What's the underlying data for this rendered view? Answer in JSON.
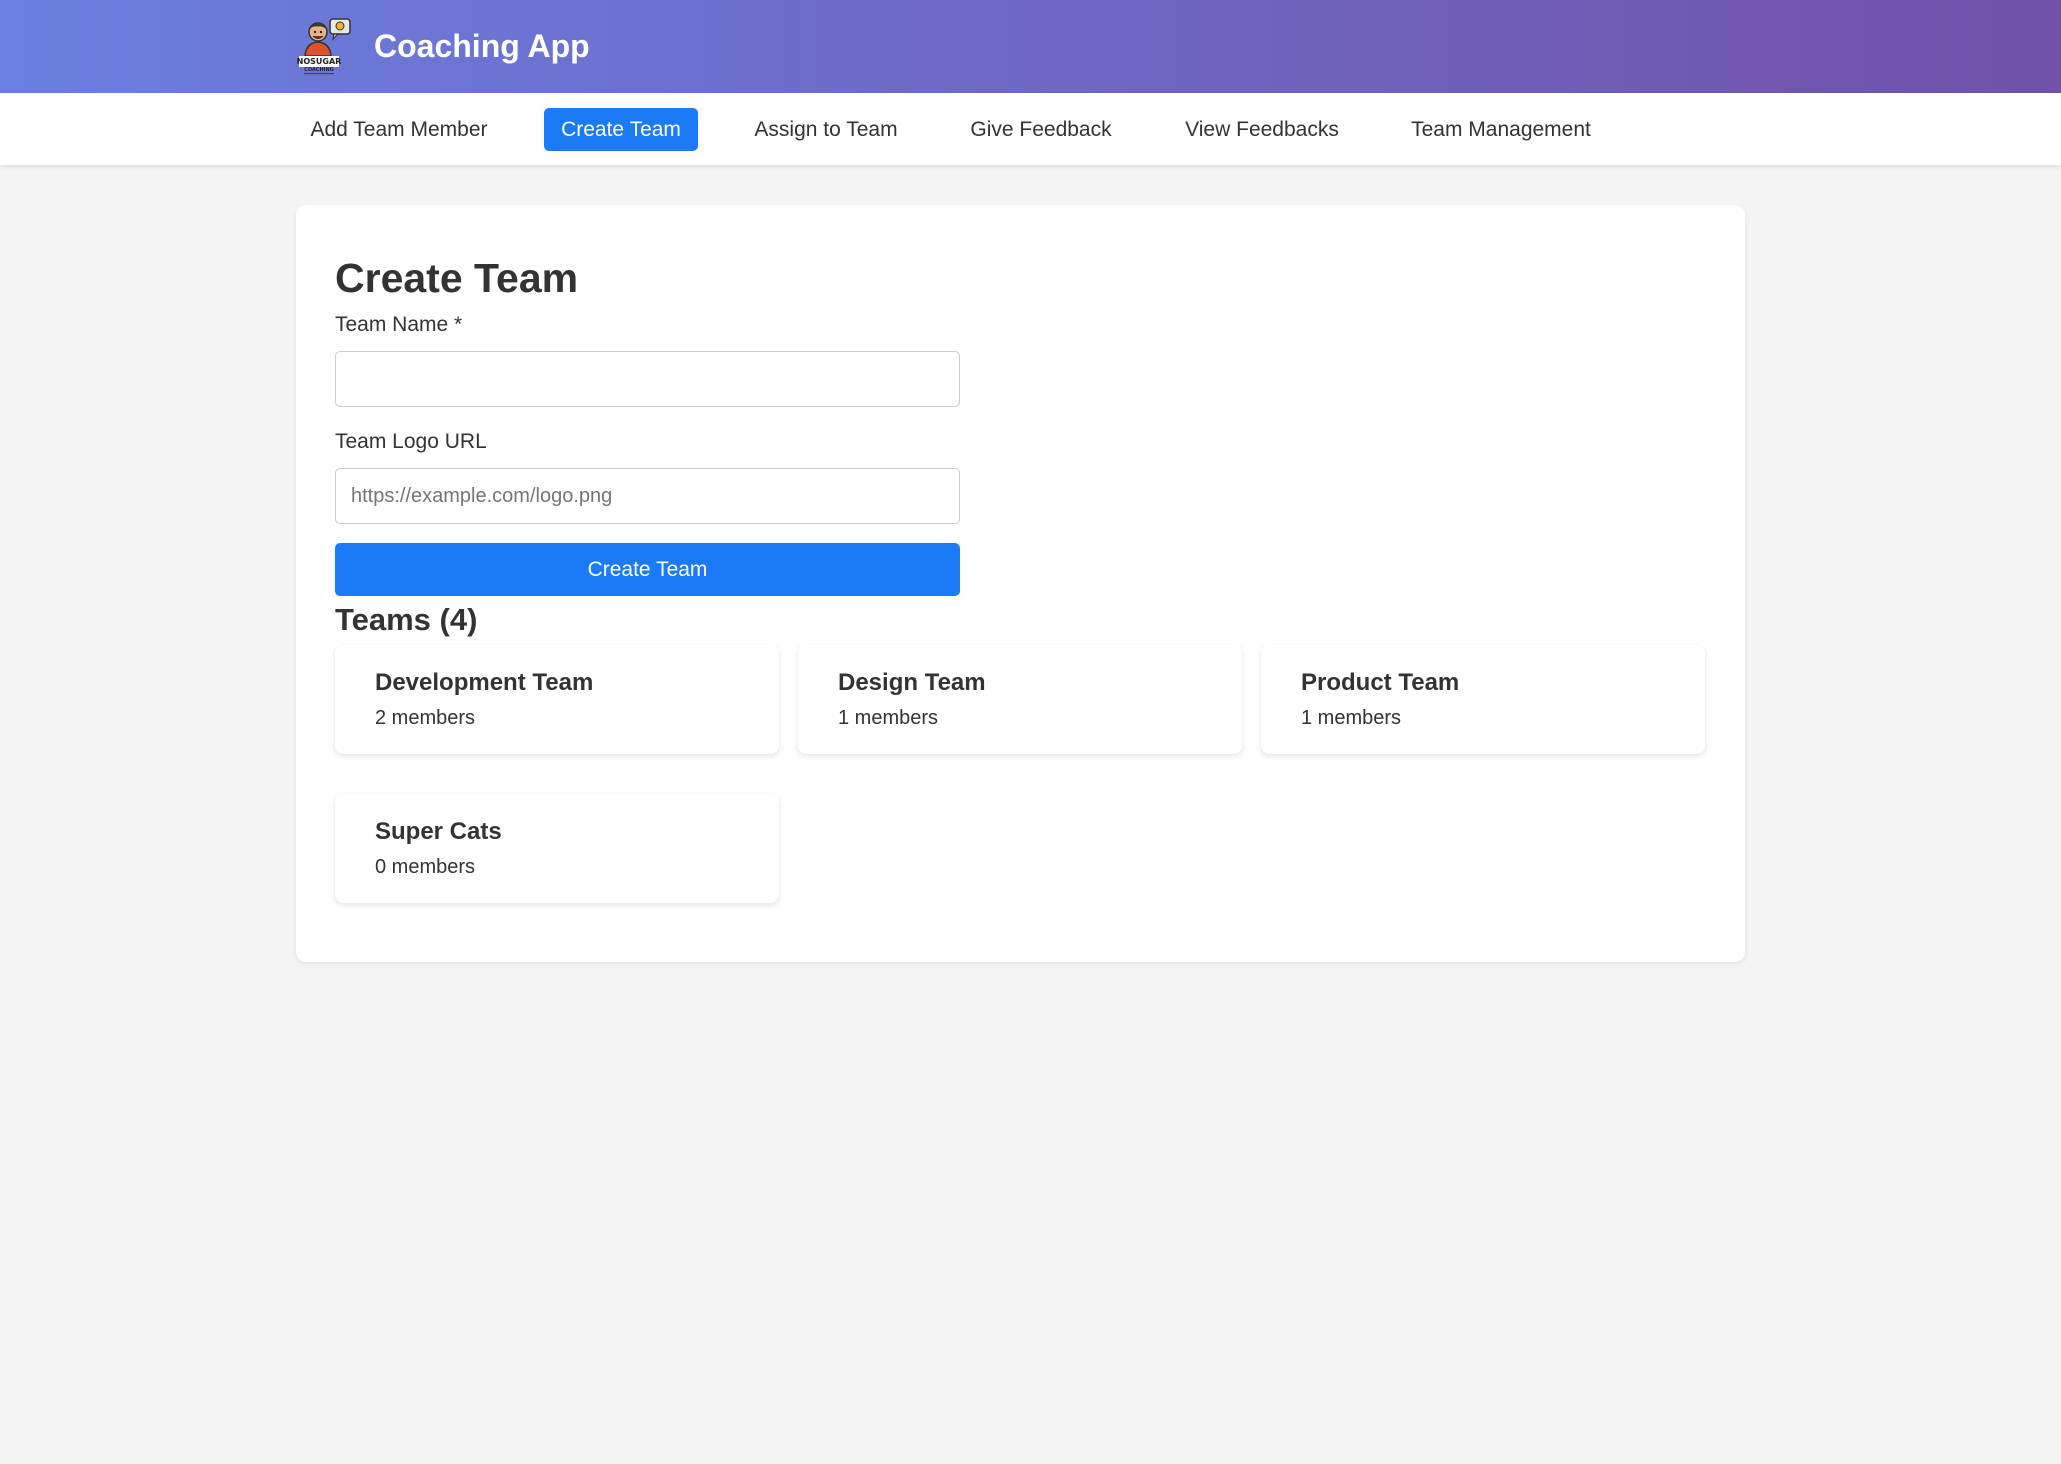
{
  "header": {
    "app_title": "Coaching App",
    "logo_text": "NOSUGAR",
    "logo_subtext": "COACHING"
  },
  "nav": {
    "items": [
      {
        "label": "Add Team Member",
        "active": false
      },
      {
        "label": "Create Team",
        "active": true
      },
      {
        "label": "Assign to Team",
        "active": false
      },
      {
        "label": "Give Feedback",
        "active": false
      },
      {
        "label": "View Feedbacks",
        "active": false
      },
      {
        "label": "Team Management",
        "active": false
      }
    ]
  },
  "form": {
    "title": "Create Team",
    "team_name_label": "Team Name *",
    "team_name_value": "",
    "team_name_placeholder": "",
    "logo_url_label": "Team Logo URL",
    "logo_url_value": "",
    "logo_url_placeholder": "https://example.com/logo.png",
    "submit_label": "Create Team"
  },
  "teams": {
    "heading": "Teams (4)",
    "items": [
      {
        "name": "Development Team",
        "members": "2 members"
      },
      {
        "name": "Design Team",
        "members": "1 members"
      },
      {
        "name": "Product Team",
        "members": "1 members"
      },
      {
        "name": "Super Cats",
        "members": "0 members"
      }
    ]
  },
  "colors": {
    "header_gradient_start": "#6a7fe0",
    "header_gradient_end": "#7151a9",
    "accent": "#1a7af8",
    "page_background": "#f4f4f4",
    "card_background": "#ffffff",
    "text": "#333333"
  }
}
